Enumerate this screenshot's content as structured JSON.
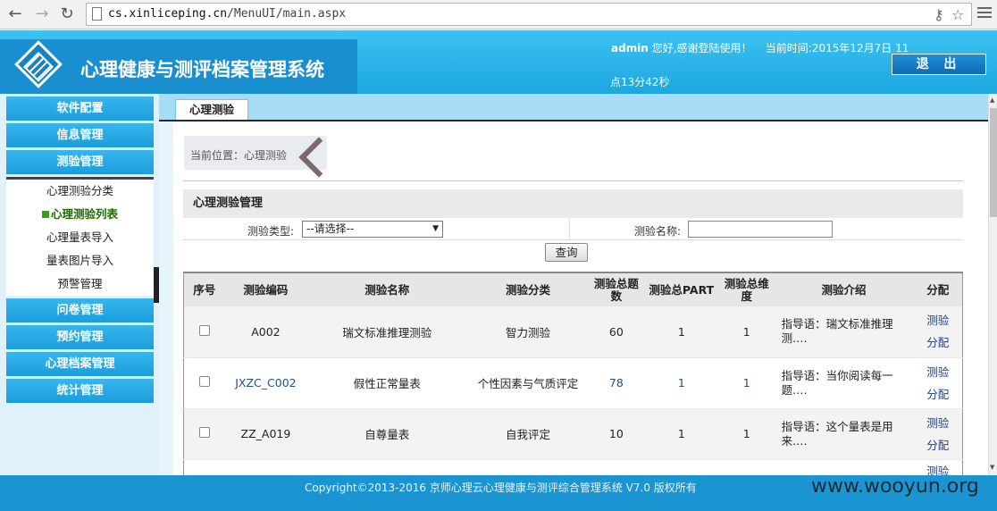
{
  "browser": {
    "url_host": "cs.xinliceping.cn",
    "url_path": "/MenuUI/main.aspx"
  },
  "header": {
    "app_title": "心理健康与测评档案管理系统",
    "username": "admin",
    "welcome_text": "您好,感谢登陆使用！",
    "time_line1": "当前时间:2015年12月7日 11",
    "time_line2": "点13分42秒",
    "logout_label": "退 出"
  },
  "sidebar": {
    "main_top": [
      {
        "label": "软件配置"
      },
      {
        "label": "信息管理"
      },
      {
        "label": "测验管理"
      }
    ],
    "sub_items": [
      {
        "label": "心理测验分类"
      },
      {
        "label": "心理测验列表"
      },
      {
        "label": "心理量表导入"
      },
      {
        "label": "量表图片导入"
      },
      {
        "label": "预警管理"
      }
    ],
    "main_bottom": [
      {
        "label": "问卷管理"
      },
      {
        "label": "预约管理"
      },
      {
        "label": "心理档案管理"
      },
      {
        "label": "统计管理"
      }
    ]
  },
  "tab": {
    "label": "心理测验"
  },
  "location": {
    "text": "当前位置：心理测验"
  },
  "panel": {
    "title": "心理测验管理",
    "type_label": "测验类型:",
    "type_value": "--请选择--",
    "name_label": "测验名称:",
    "name_value": "",
    "query_label": "查询"
  },
  "table": {
    "headers": [
      "序号",
      "测验编码",
      "测验名称",
      "测验分类",
      "测验总题数",
      "测验总PART",
      "测验总维度",
      "测验介绍",
      "分配"
    ],
    "rows": [
      {
        "code": "A002",
        "name": "瑞文标准推理测验",
        "category": "智力测验",
        "questions": "60",
        "parts": "1",
        "dims": "1",
        "intro1": "指导语：瑞文标准推理",
        "intro2": "测.…",
        "assign1": "测验分",
        "assign2": "配"
      },
      {
        "code": "JXZC_C002",
        "name": "假性正常量表",
        "category": "个性因素与气质评定",
        "questions": "78",
        "parts": "1",
        "dims": "1",
        "intro1": "指导语：当你阅读每一",
        "intro2": "题.…",
        "assign1": "测验分",
        "assign2": "配"
      },
      {
        "code": "ZZ_A019",
        "name": "自尊量表",
        "category": "自我评定",
        "questions": "10",
        "parts": "1",
        "dims": "1",
        "intro1": "指导语：这个量表是用",
        "intro2": "来.…",
        "assign1": "测验分",
        "assign2": "配"
      }
    ],
    "partial_assign": "测验分"
  },
  "footer": {
    "copyright": "Copyright©2013-2016 京师心理云心理健康与测评综合管理系统 V7.0 版权所有",
    "watermark": "www.wooyun.org"
  },
  "colors": {
    "header_blue": "#1da7e0",
    "footer_blue": "#1b94d2",
    "sidebar_button": "#1c9ddd"
  }
}
